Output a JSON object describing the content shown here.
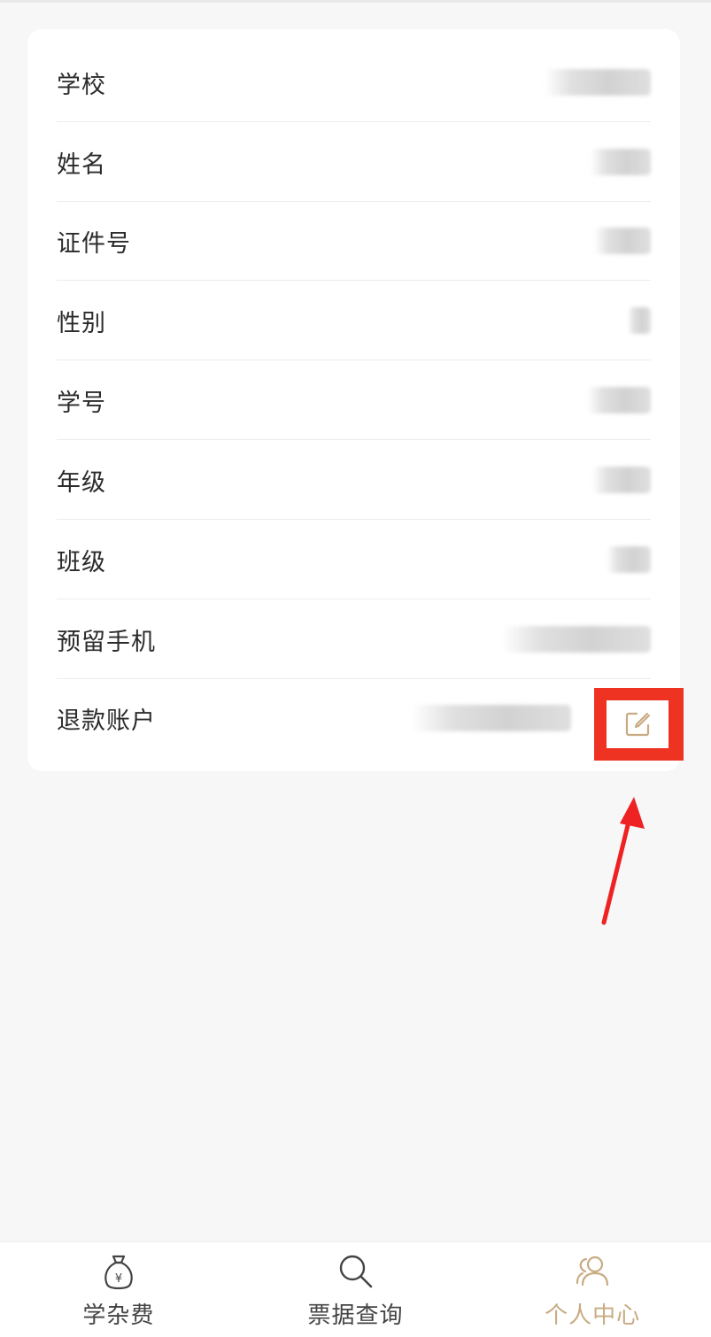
{
  "profile": {
    "rows": [
      {
        "label": "学校"
      },
      {
        "label": "姓名"
      },
      {
        "label": "证件号"
      },
      {
        "label": "性别"
      },
      {
        "label": "学号"
      },
      {
        "label": "年级"
      },
      {
        "label": "班级"
      },
      {
        "label": "预留手机"
      },
      {
        "label": "退款账户"
      }
    ]
  },
  "icons": {
    "edit": "edit-icon",
    "fee": "money-bag-icon",
    "search": "search-icon",
    "user": "users-icon"
  },
  "colors": {
    "accent": "#c8ab82",
    "highlight": "#ee3322",
    "inactive_tab": "#444444"
  },
  "tabbar": {
    "tabs": [
      {
        "label": "学杂费",
        "active": false
      },
      {
        "label": "票据查询",
        "active": false
      },
      {
        "label": "个人中心",
        "active": true
      }
    ]
  }
}
